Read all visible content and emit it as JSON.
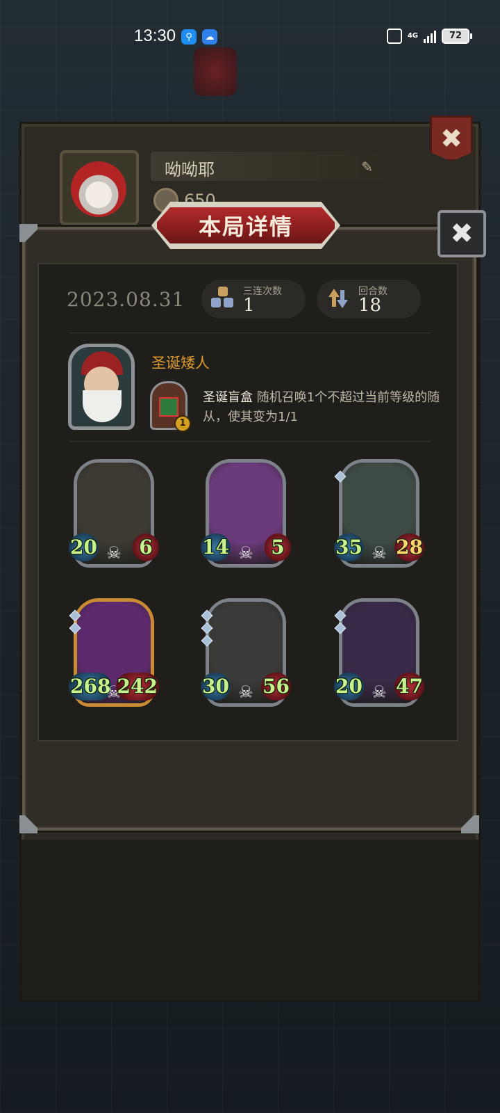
{
  "status_bar": {
    "time": "13:30",
    "app_icons": [
      "search-app-icon",
      "weather-app-icon"
    ],
    "network": "4G",
    "battery": "72"
  },
  "profile": {
    "player_name": "呦呦耶",
    "coins": "650"
  },
  "dialog": {
    "title": "本局详情",
    "date": "2023.08.31",
    "stats": [
      {
        "label": "三连次数",
        "value": "1",
        "icon": "triple-icon"
      },
      {
        "label": "回合数",
        "value": "18",
        "icon": "rounds-icon"
      }
    ],
    "hero": {
      "name": "圣诞矮人",
      "skill_title": "圣诞盲盒",
      "skill_text": "随机召唤1个不超过当前等级的随从，使其变为1/1",
      "skill_cost": "1"
    },
    "minions": [
      {
        "name": "robot-minion",
        "attack": "20",
        "health": "6",
        "frame": "silver",
        "gems": 0,
        "art_color": "#3c3a32",
        "golden_hp": false
      },
      {
        "name": "missile-minion",
        "attack": "14",
        "health": "5",
        "frame": "silver",
        "gems": 0,
        "art_color": "#6a3a7a",
        "golden_hp": false
      },
      {
        "name": "bell-robot-minion",
        "attack": "35",
        "health": "28",
        "frame": "silver",
        "gems": 1,
        "art_color": "#3e4a44",
        "golden_hp": true
      },
      {
        "name": "serpent-king-minion",
        "attack": "268",
        "health": "242",
        "frame": "gold",
        "gems": 2,
        "art_color": "#5e2a6e",
        "golden_hp": false
      },
      {
        "name": "knight-minion",
        "attack": "30",
        "health": "56",
        "frame": "silver",
        "gems": 3,
        "art_color": "#3a3a38",
        "golden_hp": false
      },
      {
        "name": "clown-minion",
        "attack": "20",
        "health": "47",
        "frame": "silver",
        "gems": 2,
        "art_color": "#3a2a4a",
        "golden_hp": false
      }
    ]
  },
  "colors": {
    "accent_red": "#b22a2a",
    "hero_name": "#d89a2e",
    "stat_green": "#c8f28e"
  }
}
